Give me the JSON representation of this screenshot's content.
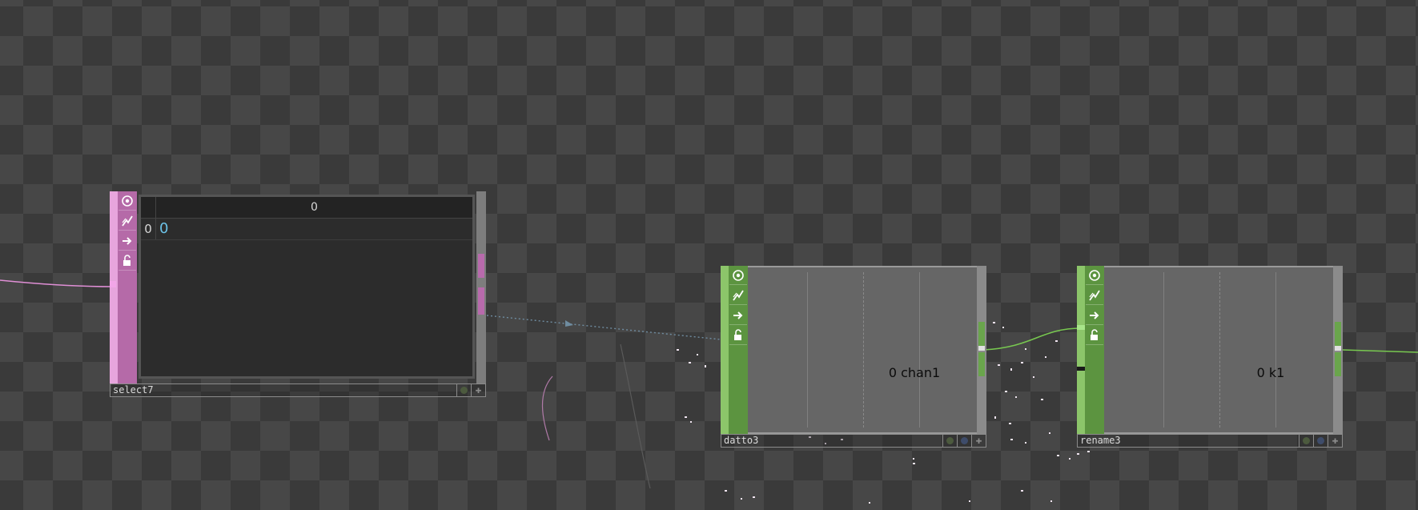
{
  "network": {
    "background": "checkerboard",
    "wire_colors": {
      "pink": "#e08fd6",
      "green": "#78c850",
      "dotted": "#6f8ca0"
    }
  },
  "nodes": {
    "select7": {
      "name": "select7",
      "color": "#d38ac9",
      "table": {
        "columns": [
          "0"
        ],
        "rows": [
          {
            "index": "0",
            "value": "0"
          }
        ]
      }
    },
    "datto3": {
      "name": "datto3",
      "color": "#6aa54c",
      "channel_label": "0 chan1"
    },
    "rename3": {
      "name": "rename3",
      "color": "#6aa54c",
      "channel_label": "0 k1"
    }
  },
  "icons": [
    "viewer-toggle-icon",
    "cook-flag-icon",
    "export-flag-icon",
    "lock-flag-icon"
  ]
}
